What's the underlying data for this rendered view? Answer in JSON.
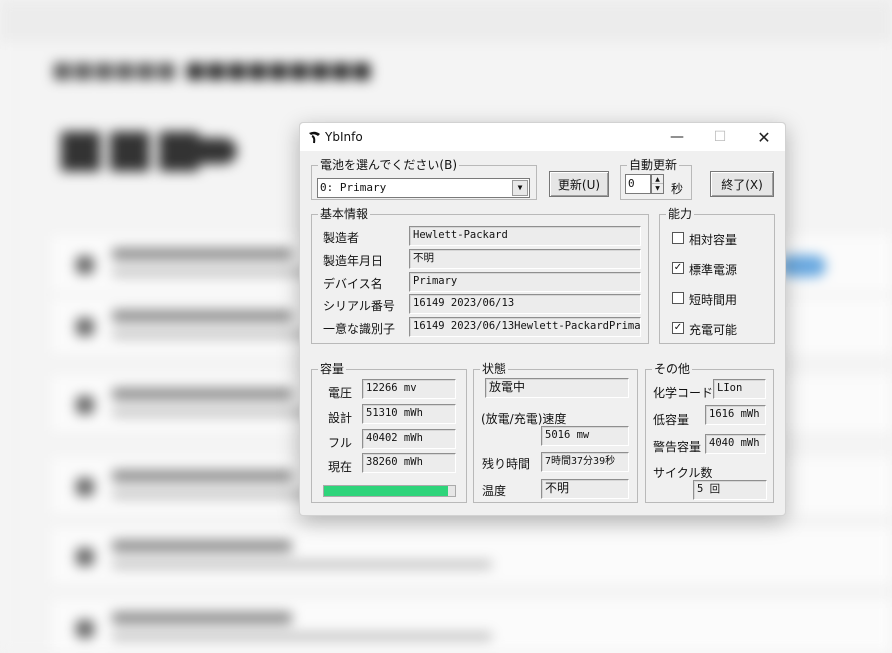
{
  "window": {
    "title": "YbInfo"
  },
  "battery_select": {
    "label": "電池を選んでください(B)",
    "value": "0: Primary"
  },
  "buttons": {
    "refresh": "更新(U)",
    "exit": "終了(X)"
  },
  "auto_refresh": {
    "label": "自動更新",
    "value": "0",
    "unit": "秒"
  },
  "basic_info": {
    "label": "基本情報",
    "rows": [
      {
        "label": "製造者",
        "value": "Hewlett-Packard"
      },
      {
        "label": "製造年月日",
        "value": "不明"
      },
      {
        "label": "デバイス名",
        "value": "Primary"
      },
      {
        "label": "シリアル番号",
        "value": "16149 2023/06/13"
      },
      {
        "label": "一意な識別子",
        "value": "16149 2023/06/13Hewlett-PackardPrimary"
      }
    ]
  },
  "capability": {
    "label": "能力",
    "items": [
      {
        "label": "相対容量",
        "checked": false,
        "mark": ""
      },
      {
        "label": "標準電源",
        "checked": true,
        "mark": "✓"
      },
      {
        "label": "短時間用",
        "checked": false,
        "mark": ""
      },
      {
        "label": "充電可能",
        "checked": true,
        "mark": "✓"
      }
    ]
  },
  "capacity": {
    "label": "容量",
    "rows": [
      {
        "label": "電圧",
        "value": "12266 mv"
      },
      {
        "label": "設計",
        "value": "51310 mWh"
      },
      {
        "label": "フル",
        "value": "40402 mWh"
      },
      {
        "label": "現在",
        "value": "38260 mWh"
      }
    ],
    "charge_level": 0.947,
    "charge_color": "#2ed47a"
  },
  "status": {
    "label": "状態",
    "state": "放電中",
    "rate_label": "(放電/充電)速度",
    "rate": "5016 mw",
    "remaining_label": "残り時間",
    "remaining": "7時間37分39秒",
    "temp_label": "温度",
    "temp": "不明"
  },
  "other": {
    "label": "その他",
    "chem_label": "化学コード",
    "chem": "LIon",
    "low_label": "低容量",
    "low": "1616 mWh",
    "warn_label": "警告容量",
    "warn": "4040 mWh",
    "cycle_label": "サイクル数",
    "cycle": "5 回"
  }
}
